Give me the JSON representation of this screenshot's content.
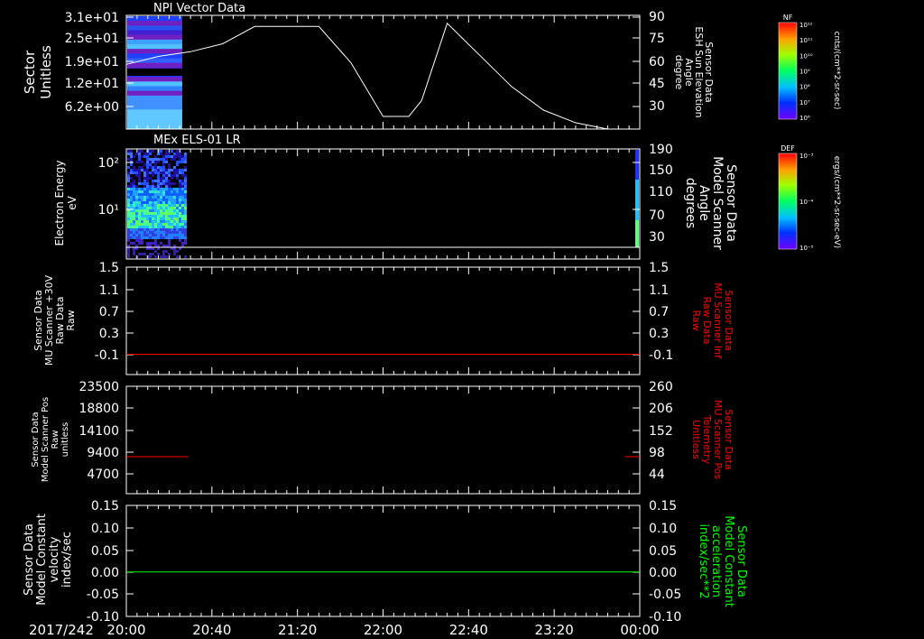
{
  "colors": {
    "background": "#000000",
    "axes": "#ffffff",
    "red_trace": "#ff0000",
    "green_trace": "#00ff00"
  },
  "time_axis": {
    "date_label": "2017/242",
    "ticks": [
      "20:00",
      "20:40",
      "21:20",
      "22:00",
      "22:40",
      "23:20",
      "00:00"
    ]
  },
  "chart_data": [
    {
      "type": "heatmap",
      "title": "NPI Vector Data",
      "ylabel": [
        "Sector",
        "Unitless"
      ],
      "y_ticks": [
        "3.1e+01",
        "2.5e+01",
        "1.9e+01",
        "1.2e+01",
        "6.2e+00"
      ],
      "right_ylabel": [
        "Sensor Data",
        "ESH Sun Elevation",
        "Angle",
        "degree"
      ],
      "right_ticks": [
        "90",
        "75",
        "60",
        "45",
        "30"
      ],
      "right_ylim": [
        18,
        90
      ],
      "colorbar": {
        "label": "NF",
        "units": "cnts/(cm**2-sr-sec)",
        "ticks": [
          "10¹²",
          "10¹¹",
          "10¹⁰",
          "10⁹",
          "10⁸",
          "10⁷",
          "10⁶"
        ]
      },
      "heatmap_time_range_hours": [
        0,
        0.857
      ],
      "line_series": {
        "name": "Sensor Data ESH Sun Elevation Angle",
        "x_hours": [
          0,
          0.5,
          1.0,
          1.5,
          2.0,
          2.5,
          3.0,
          3.5,
          4.0,
          4.4,
          4.6,
          5.0,
          5.5,
          6.0,
          6.5,
          7.0,
          7.5,
          8.0
        ],
        "y": [
          59,
          64,
          67,
          72,
          83,
          83,
          83,
          60,
          26,
          26,
          36,
          85,
          65,
          45,
          30,
          22,
          18,
          18
        ]
      }
    },
    {
      "type": "heatmap",
      "title": "MEx ELS-01 LR",
      "ylabel": [
        "Electron Energy",
        "eV"
      ],
      "y_ticks": [
        "10²",
        "10¹"
      ],
      "right_ylabel": [
        "Sensor Data",
        "Model Scanner",
        "Angle",
        "degrees"
      ],
      "right_ticks": [
        "190",
        "150",
        "110",
        "70",
        "30"
      ],
      "colorbar": {
        "label": "DEF",
        "units": "ergs/(cm**2-sr-sec-eV)",
        "ticks": [
          "10⁻³",
          "10⁻⁴",
          "10⁻⁵"
        ]
      },
      "heatmap_time_range_hours": [
        0,
        0.93
      ]
    },
    {
      "type": "line",
      "ylabel": [
        "Sensor Data",
        "MU Scanner +30V",
        "Raw Data",
        "Raw"
      ],
      "y_ticks": [
        "1.5",
        "1.1",
        "0.7",
        "0.3",
        "-0.1"
      ],
      "ylim": [
        -0.35,
        1.5
      ],
      "right_ylabel": [
        "Sensor Data",
        "MU Scanner Inf",
        "Raw Data",
        "Raw"
      ],
      "right_ticks": [
        "1.5",
        "1.1",
        "0.7",
        "0.3",
        "-0.1"
      ],
      "series": [
        {
          "x_hours": [
            0,
            8
          ],
          "y": [
            0.0
          ]
        }
      ]
    },
    {
      "type": "line",
      "ylabel": [
        "Sensor Data",
        "Model Scanner Pos",
        "Raw",
        "unitless"
      ],
      "y_ticks": [
        "23500",
        "18800",
        "14100",
        "9400",
        "4700"
      ],
      "ylim": [
        0,
        23500
      ],
      "right_ylabel": [
        "Sensor Data",
        "MU Scanner Pos",
        "Telemetry",
        "Unitless"
      ],
      "right_ticks": [
        "260",
        "206",
        "152",
        "98",
        "44"
      ],
      "series": [
        {
          "x_hours": [
            0,
            0.97
          ],
          "y": [
            8100
          ]
        },
        {
          "x_hours": [
            7.77,
            8.0
          ],
          "y": [
            8100
          ]
        }
      ]
    },
    {
      "type": "line",
      "ylabel": [
        "Sensor Data",
        "Model Constant",
        "velocity",
        "index/sec"
      ],
      "y_ticks": [
        "0.15",
        "0.10",
        "0.05",
        "0.00",
        "-0.05",
        "-0.10"
      ],
      "ylim": [
        -0.1,
        0.15
      ],
      "right_ylabel": [
        "Sensor Data",
        "Model Constant",
        "acceleration",
        "index/sec**2"
      ],
      "right_ticks": [
        "0.15",
        "0.10",
        "0.05",
        "0.00",
        "-0.05",
        "-0.10"
      ],
      "series": [
        {
          "x_hours": [
            0,
            8
          ],
          "y": [
            0.0
          ]
        }
      ]
    }
  ]
}
